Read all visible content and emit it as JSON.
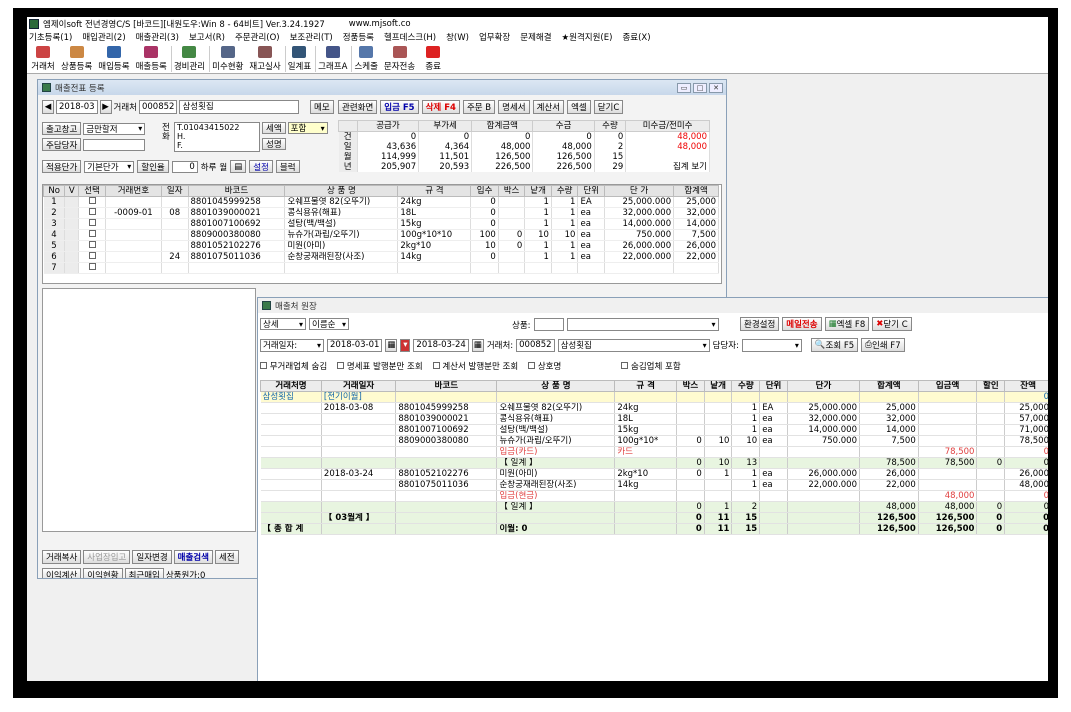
{
  "app": {
    "title": "엠제이soft 전년경영C/S [바코드][내원도우:Win 8 - 64비트] Ver.3.24.1927",
    "url": "www.mjsoft.co",
    "menu": [
      "기초등록(1)",
      "매입관리(2)",
      "매출관리(3)",
      "보고서(R)",
      "주문관리(O)",
      "보조관리(T)",
      "정품등록",
      "헬프데스크(H)",
      "창(W)",
      "업무확장",
      "문제해결",
      "★원격지원(E)",
      "종료(X)"
    ],
    "toolbar": [
      "거래처",
      "상품등록",
      "매입등록",
      "매출등록",
      "경비관리",
      "미수현황",
      "재고실사",
      "일계표",
      "그래프A",
      "스케줄",
      "문자전송",
      "종료"
    ]
  },
  "sales": {
    "title": "매출전표 등록",
    "month": "2018-03",
    "client_label": "거래처",
    "client_code": "000852",
    "client_name": "삼성횟집",
    "memo": "메모",
    "buttons": [
      "관련화면",
      "입금 F5",
      "삭제 F4",
      "주문 B",
      "명세서",
      "계산서",
      "엑셀",
      "닫기C"
    ],
    "warehouse_label": "출고창고",
    "warehouse": "금만할저",
    "manager_label": "주담당자",
    "phone_label": "전화",
    "phone": "T.01043415022",
    "h": "H.",
    "f": "F.",
    "tax_label": "세액",
    "tax": "포함",
    "stamp": "성명",
    "price_label": "적용단가",
    "price": "기본단가",
    "discount_label": "할인율",
    "discount": "0",
    "round1": "하루",
    "round2": "월",
    "setting": "설정",
    "block": "블럭",
    "summary": {
      "headers": [
        "",
        "공급가",
        "부가세",
        "합계금액",
        "수금",
        "수량",
        "미수금/전미수"
      ],
      "rows": [
        [
          "건",
          "0",
          "0",
          "0",
          "0",
          "0",
          "48,000"
        ],
        [
          "일",
          "43,636",
          "4,364",
          "48,000",
          "48,000",
          "2",
          "48,000"
        ],
        [
          "월",
          "114,999",
          "11,501",
          "126,500",
          "126,500",
          "15",
          ""
        ],
        [
          "년",
          "205,907",
          "20,593",
          "226,500",
          "226,500",
          "29",
          "집계 보기"
        ]
      ]
    },
    "grid": {
      "headers": [
        "No",
        "V",
        "선택",
        "거래번호",
        "일자",
        "바코드",
        "상 품 명",
        "규 격",
        "입수",
        "박스",
        "낱개",
        "수량",
        "단위",
        "단 가",
        "합계액"
      ],
      "rows": [
        [
          "1",
          "",
          "",
          "",
          "",
          "8801045999258",
          "오쉐프물엿 82(오뚜기)",
          "24kg",
          "0",
          "",
          "1",
          "1",
          "EA",
          "25,000.000",
          "25,000"
        ],
        [
          "2",
          "",
          "",
          "-0009-01",
          "08",
          "8801039000021",
          "콩식용유(해표)",
          "18L",
          "0",
          "",
          "1",
          "1",
          "ea",
          "32,000.000",
          "32,000"
        ],
        [
          "3",
          "",
          "",
          "",
          "",
          "8801007100692",
          "설탕(백/백설)",
          "15kg",
          "0",
          "",
          "1",
          "1",
          "ea",
          "14,000.000",
          "14,000"
        ],
        [
          "4",
          "",
          "",
          "",
          "",
          "8809000380080",
          "뉴슈가(과립/오뚜기)",
          "100g*10*10",
          "100",
          "0",
          "10",
          "10",
          "ea",
          "750.000",
          "7,500"
        ],
        [
          "5",
          "",
          "",
          "",
          "",
          "8801052102276",
          "미원(아미)",
          "2kg*10",
          "10",
          "0",
          "1",
          "1",
          "ea",
          "26,000.000",
          "26,000"
        ],
        [
          "6",
          "",
          "",
          "",
          "24",
          "8801075011036",
          "순창궁재래된장(사조)",
          "14kg",
          "0",
          "",
          "1",
          "1",
          "ea",
          "22,000.000",
          "22,000"
        ],
        [
          "7",
          "",
          "",
          "",
          "",
          "",
          "",
          "",
          "",
          "",
          "",
          "",
          "",
          "",
          ""
        ]
      ]
    },
    "bottom1": [
      "거래복사",
      "사업장입고",
      "일자변경",
      "매출검색",
      "세전"
    ],
    "bottom2": [
      "이익계산",
      "이익현황",
      "최근매입"
    ],
    "cost": "상품원가:0"
  },
  "ledger": {
    "title": "매출처 원장",
    "view": "상세",
    "sort": "이름순",
    "product_label": "상품:",
    "env": "환경설정",
    "mail": "메일전송",
    "excel": "엑셀 F8",
    "close": "닫기 C",
    "date_label": "거래일자:",
    "date_from": "2018-03-01",
    "date_to": "2018-03-24",
    "client_label": "거래처:",
    "client_code": "000852",
    "client_name": "삼성횟집",
    "manager_label": "담당자:",
    "query": "조회 F5",
    "print": "인쇄 F7",
    "filters": [
      "무거래업체 숨김",
      "명세표 발행분만 조회",
      "계산서 발행분만 조회",
      "상호명",
      "숨김업체 포함"
    ],
    "headers": [
      "거래처명",
      "거래일자",
      "바코드",
      "상 품 명",
      "규 격",
      "박스",
      "낱개",
      "수량",
      "단위",
      "단가",
      "합계액",
      "입금액",
      "할인",
      "잔액"
    ],
    "rows": [
      {
        "t": "prev",
        "c": [
          "삼성횟집",
          "[전기이월]",
          "",
          "",
          "",
          "",
          "",
          "",
          "",
          "",
          "",
          "",
          "",
          "0"
        ]
      },
      {
        "t": "",
        "c": [
          "",
          "2018-03-08",
          "8801045999258",
          "오쉐프물엿 82(오뚜기)",
          "24kg",
          "",
          "",
          "1",
          "EA",
          "25,000.000",
          "25,000",
          "",
          "",
          "25,000"
        ]
      },
      {
        "t": "",
        "c": [
          "",
          "",
          "8801039000021",
          "콩식용유(해표)",
          "18L",
          "",
          "",
          "1",
          "ea",
          "32,000.000",
          "32,000",
          "",
          "",
          "57,000"
        ]
      },
      {
        "t": "",
        "c": [
          "",
          "",
          "8801007100692",
          "설탕(백/백설)",
          "15kg",
          "",
          "",
          "1",
          "ea",
          "14,000.000",
          "14,000",
          "",
          "",
          "71,000"
        ]
      },
      {
        "t": "",
        "c": [
          "",
          "",
          "8809000380080",
          "뉴슈가(과립/오뚜기)",
          "100g*10*",
          "0",
          "10",
          "10",
          "ea",
          "750.000",
          "7,500",
          "",
          "",
          "78,500"
        ]
      },
      {
        "t": "pay",
        "c": [
          "",
          "",
          "",
          "입금(카드)",
          "카드",
          "",
          "",
          "",
          "",
          "",
          "",
          "78,500",
          "",
          "0"
        ]
      },
      {
        "t": "sub",
        "c": [
          "",
          "",
          "",
          "【 일계 】",
          "",
          "0",
          "10",
          "13",
          "",
          "",
          "78,500",
          "78,500",
          "0",
          "0"
        ]
      },
      {
        "t": "",
        "c": [
          "",
          "2018-03-24",
          "8801052102276",
          "미원(아미)",
          "2kg*10",
          "0",
          "1",
          "1",
          "ea",
          "26,000.000",
          "26,000",
          "",
          "",
          "26,000"
        ]
      },
      {
        "t": "",
        "c": [
          "",
          "",
          "8801075011036",
          "순창궁재래된장(사조)",
          "14kg",
          "",
          "",
          "1",
          "ea",
          "22,000.000",
          "22,000",
          "",
          "",
          "48,000"
        ]
      },
      {
        "t": "pay",
        "c": [
          "",
          "",
          "",
          "입금(현금)",
          "",
          "",
          "",
          "",
          "",
          "",
          "",
          "48,000",
          "",
          "0"
        ]
      },
      {
        "t": "sub",
        "c": [
          "",
          "",
          "",
          "【 일계 】",
          "",
          "0",
          "1",
          "2",
          "",
          "",
          "48,000",
          "48,000",
          "0",
          "0"
        ]
      },
      {
        "t": "tot",
        "c": [
          "",
          "【 03월계 】",
          "",
          "",
          "",
          "0",
          "11",
          "15",
          "",
          "",
          "126,500",
          "126,500",
          "0",
          "0"
        ]
      },
      {
        "t": "tot",
        "c": [
          "【 총 합 계",
          "",
          "",
          "이월: 0",
          "",
          "0",
          "11",
          "15",
          "",
          "",
          "126,500",
          "126,500",
          "0",
          "0"
        ]
      }
    ]
  }
}
